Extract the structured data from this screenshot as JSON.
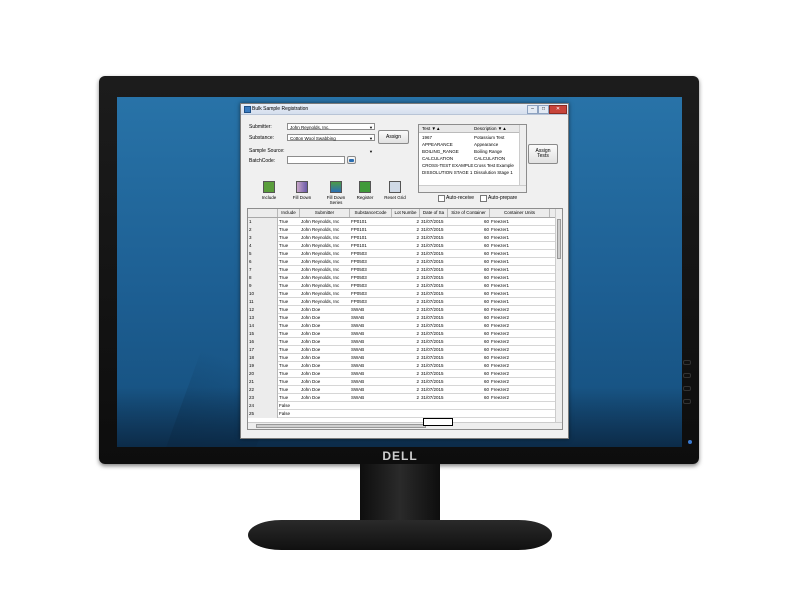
{
  "monitor": {
    "brand": "DELL"
  },
  "window": {
    "title": "Bulk Sample Registration",
    "minimize": "–",
    "maximize": "□",
    "close": "✕"
  },
  "form": {
    "submitter_label": "Submitter:",
    "submitter_value": "John Reynolds, Inc.",
    "substance_label": "Substance:",
    "substance_value": "Cotton Wool Swabbing",
    "assign_label": "Assign",
    "sample_source_label": "Sample Source:",
    "batchcode_label": "BatchCode:"
  },
  "tests": {
    "col_test": "Test ▼▲",
    "col_desc": "Description ▼▲",
    "rows": [
      {
        "test": "1967",
        "desc": "Potassium Test"
      },
      {
        "test": "APPEARANCE",
        "desc": "Appearance"
      },
      {
        "test": "BOILING_RANGE",
        "desc": "Boiling Range"
      },
      {
        "test": "CALCULATION",
        "desc": "CALCULATION"
      },
      {
        "test": "CROSS-TEST EXAMPLE",
        "desc": "Cross Test Example"
      },
      {
        "test": "DISSOLUTION STAGE 1",
        "desc": "Dissolution Stage 1"
      }
    ],
    "assign_tests_line1": "Assign",
    "assign_tests_line2": "Tests"
  },
  "toolbar": {
    "include": "Include",
    "filldown": "Fill Down",
    "filldown_series_line1": "Fill Down",
    "filldown_series_line2": "Series",
    "register": "Register",
    "reset": "Reset Grid",
    "auto_receive": "Auto-receive",
    "auto_prepare": "Auto-prepare"
  },
  "grid": {
    "headers": [
      "",
      "Include",
      "Submitter",
      "SubstanceCode",
      "Lot Numbe",
      "Date of Sa",
      "Size of Container",
      "Container Units"
    ],
    "rows": [
      [
        "1",
        "True",
        "John Reynolds, Inc",
        "FP0101",
        "2",
        "31/07/2015",
        "60",
        "Freezer1"
      ],
      [
        "2",
        "True",
        "John Reynolds, Inc",
        "FP0101",
        "2",
        "31/07/2015",
        "60",
        "Freezer1"
      ],
      [
        "3",
        "True",
        "John Reynolds, Inc",
        "FP0101",
        "2",
        "31/07/2015",
        "60",
        "Freezer1"
      ],
      [
        "4",
        "True",
        "John Reynolds, Inc",
        "FP0101",
        "2",
        "31/07/2015",
        "60",
        "Freezer1"
      ],
      [
        "5",
        "True",
        "John Reynolds, Inc",
        "FP0503",
        "2",
        "31/07/2015",
        "60",
        "Freezer1"
      ],
      [
        "6",
        "True",
        "John Reynolds, Inc",
        "FP0503",
        "2",
        "31/07/2015",
        "60",
        "Freezer1"
      ],
      [
        "7",
        "True",
        "John Reynolds, Inc",
        "FP0503",
        "2",
        "31/07/2015",
        "60",
        "Freezer1"
      ],
      [
        "8",
        "True",
        "John Reynolds, Inc",
        "FP0503",
        "2",
        "31/07/2015",
        "60",
        "Freezer1"
      ],
      [
        "9",
        "True",
        "John Reynolds, Inc",
        "FP0503",
        "2",
        "31/07/2015",
        "60",
        "Freezer1"
      ],
      [
        "10",
        "True",
        "John Reynolds, Inc",
        "FP0503",
        "2",
        "31/07/2015",
        "60",
        "Freezer1"
      ],
      [
        "11",
        "True",
        "John Reynolds, Inc",
        "FP0503",
        "2",
        "31/07/2015",
        "60",
        "Freezer1"
      ],
      [
        "12",
        "True",
        "John Doe",
        "SWAB",
        "2",
        "31/07/2015",
        "60",
        "Freezer2"
      ],
      [
        "13",
        "True",
        "John Doe",
        "SWAB",
        "2",
        "31/07/2015",
        "60",
        "Freezer2"
      ],
      [
        "14",
        "True",
        "John Doe",
        "SWAB",
        "2",
        "31/07/2015",
        "60",
        "Freezer2"
      ],
      [
        "15",
        "True",
        "John Doe",
        "SWAB",
        "2",
        "31/07/2015",
        "60",
        "Freezer2"
      ],
      [
        "16",
        "True",
        "John Doe",
        "SWAB",
        "2",
        "31/07/2015",
        "60",
        "Freezer2"
      ],
      [
        "17",
        "True",
        "John Doe",
        "SWAB",
        "2",
        "31/07/2015",
        "60",
        "Freezer2"
      ],
      [
        "18",
        "True",
        "John Doe",
        "SWAB",
        "2",
        "31/07/2015",
        "60",
        "Freezer2"
      ],
      [
        "19",
        "True",
        "John Doe",
        "SWAB",
        "2",
        "31/07/2015",
        "60",
        "Freezer2"
      ],
      [
        "20",
        "True",
        "John Doe",
        "SWAB",
        "2",
        "31/07/2015",
        "60",
        "Freezer2"
      ],
      [
        "21",
        "True",
        "John Doe",
        "SWAB",
        "2",
        "31/07/2015",
        "60",
        "Freezer2"
      ],
      [
        "22",
        "True",
        "John Doe",
        "SWAB",
        "2",
        "31/07/2015",
        "60",
        "Freezer2"
      ],
      [
        "23",
        "True",
        "John Doe",
        "SWAB",
        "2",
        "31/07/2015",
        "60",
        "Freezer2"
      ],
      [
        "24",
        "False",
        "",
        "",
        "",
        "",
        "",
        ""
      ],
      [
        "25",
        "False",
        "",
        "",
        "",
        "",
        "",
        ""
      ]
    ]
  },
  "icons": {
    "window": "app-window-icon",
    "include": "include-icon",
    "filldown": "fill-down-icon",
    "filldown_series": "fill-down-series-icon",
    "register": "register-icon",
    "reset": "reset-grid-icon",
    "batch_lookup": "lookup-icon"
  },
  "colors": {
    "desktop": "#1d5f93",
    "accent": "#3a7bbf"
  }
}
